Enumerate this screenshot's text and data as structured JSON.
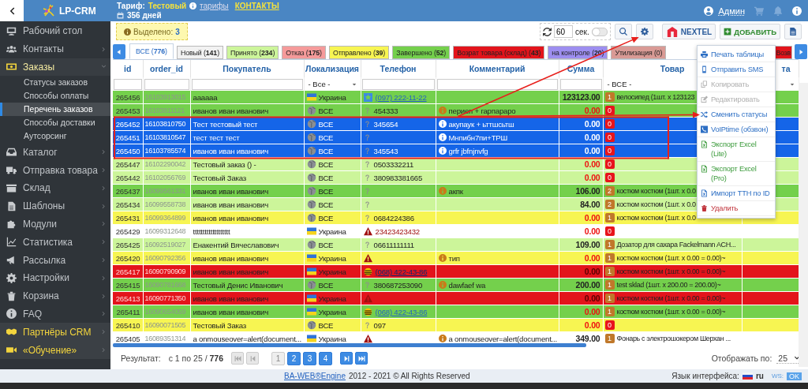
{
  "header": {
    "logo": "LP-CRM",
    "tariff_label": "Тариф:",
    "tariff": "Тестовый",
    "tariffs_link": "тарифы",
    "contacts_link": "КОНТАКТЫ",
    "days": "356 дней",
    "user": "Админ"
  },
  "sidebar": {
    "items": [
      {
        "label": "Рабочий стол",
        "has_arrow": false,
        "expanded": false,
        "highlight": false
      },
      {
        "label": "Контакты",
        "has_arrow": true,
        "expanded": false,
        "highlight": false
      },
      {
        "label": "Заказы",
        "has_arrow": true,
        "expanded": true,
        "highlight": false,
        "children": [
          {
            "label": "Статусы заказов",
            "selected": false
          },
          {
            "label": "Способы оплаты",
            "selected": false
          },
          {
            "label": "Перечень заказов",
            "selected": true
          },
          {
            "label": "Способы доставки",
            "selected": false
          },
          {
            "label": "Аутсорсинг",
            "selected": false
          }
        ]
      },
      {
        "label": "Каталог",
        "has_arrow": true,
        "expanded": false,
        "highlight": false
      },
      {
        "label": "Отправка товара",
        "has_arrow": true,
        "expanded": false,
        "highlight": false
      },
      {
        "label": "Склад",
        "has_arrow": true,
        "expanded": false,
        "highlight": false
      },
      {
        "label": "Шаблоны",
        "has_arrow": true,
        "expanded": false,
        "highlight": false
      },
      {
        "label": "Модули",
        "has_arrow": true,
        "expanded": false,
        "highlight": false
      },
      {
        "label": "Статистика",
        "has_arrow": true,
        "expanded": false,
        "highlight": false
      },
      {
        "label": "Рассылка",
        "has_arrow": true,
        "expanded": false,
        "highlight": false
      },
      {
        "label": "Настройки",
        "has_arrow": true,
        "expanded": false,
        "highlight": false
      },
      {
        "label": "Корзина",
        "has_arrow": true,
        "expanded": false,
        "highlight": false
      },
      {
        "label": "FAQ",
        "has_arrow": true,
        "expanded": false,
        "highlight": false
      },
      {
        "label": "Партнёры CRM",
        "has_arrow": true,
        "expanded": false,
        "highlight": true
      },
      {
        "label": "«Обучение»",
        "has_arrow": true,
        "expanded": false,
        "highlight": true
      }
    ]
  },
  "toolbar": {
    "selected_label": "Выделено:",
    "selected_count": "3",
    "refresh_value": "60",
    "refresh_unit": "сек.",
    "auto_refresh": false,
    "nextel": "NEXTEL",
    "add": "ДОБАВИТЬ"
  },
  "tabs": [
    {
      "label": "ВСЕ (**776**)",
      "selected": true,
      "color": "#ffffff"
    },
    {
      "label": "Новый (**141**)",
      "selected": false,
      "color": "#f2f2f2"
    },
    {
      "label": "Принято (**234**)",
      "selected": false,
      "color": "#ccf59a"
    },
    {
      "label": "Отказ (**175**)",
      "selected": false,
      "color": "#f59a9a"
    },
    {
      "label": "Отправлено (**39**)",
      "selected": false,
      "color": "#f7f552"
    },
    {
      "label": "Завершено (**52**)",
      "selected": false,
      "color": "#74d04c"
    },
    {
      "label": "Возрат товара (склад) (**43**)",
      "selected": false,
      "color": "#e3141b"
    },
    {
      "label": "на контроле (**20**)",
      "selected": false,
      "color": "#9d8ef0"
    },
    {
      "label": "Утилизация (0)",
      "selected": false,
      "color": "#d99a95"
    },
    {
      "label": "Возв",
      "selected": false,
      "color": "#e3141b"
    }
  ],
  "table": {
    "columns": [
      "id",
      "order_id",
      "Покупатель",
      "Локализация",
      "Телефон",
      "Комментарий",
      "Сумма",
      "Товар",
      "та"
    ],
    "filters": [
      {
        "kind": "text"
      },
      {
        "kind": "text"
      },
      {
        "kind": "text"
      },
      {
        "kind": "select",
        "value": "- Все -"
      },
      {
        "kind": "text"
      },
      {
        "kind": "text"
      },
      {
        "kind": "text"
      },
      {
        "kind": "select",
        "value": "- ВСЕ -"
      }
    ],
    "rows": [
      {
        "id": "265456",
        "order_id": "16103913015",
        "buyer": "аааааа",
        "location": {
          "kind": "flag",
          "label": "Украина"
        },
        "phone": {
          "kind": "star",
          "number": "(097) 222-11-22",
          "link": true
        },
        "comment": "",
        "sum": "123123.00",
        "sum_alert": false,
        "badge": {
          "count": "1",
          "color": "#c0782a"
        },
        "product": "велосипед (1шт. x 123123",
        "color": "#74d04c",
        "selected": false
      },
      {
        "id": "265453",
        "order_id": "16103811121",
        "buyer": "иванов иван иванович",
        "location": {
          "kind": "globe",
          "label": "ВСЕ"
        },
        "phone": {
          "kind": "unknown",
          "number": "454333",
          "link": false
        },
        "comment": "периеп + гарпараро",
        "sum": "0.00",
        "sum_alert": true,
        "badge": {
          "count": "0",
          "color": "#e8141c"
        },
        "product": "",
        "color": "#74d04c",
        "selected": false
      },
      {
        "id": "265452",
        "order_id": "16103810750",
        "buyer": "Тест тестовый тест",
        "location": {
          "kind": "globe",
          "label": "ВСЕ"
        },
        "phone": {
          "kind": "unknown",
          "number": "345654",
          "link": false
        },
        "comment": "акупаук + ьттшсьтш",
        "sum": "0.00",
        "sum_alert": true,
        "badge": {
          "count": "0",
          "color": "#e8141c"
        },
        "product": "",
        "selected": true
      },
      {
        "id": "265451",
        "order_id": "16103810547",
        "buyer": "тест тест тест",
        "location": {
          "kind": "globe",
          "label": "ВСЕ"
        },
        "phone": {
          "kind": "unknown"
        },
        "comment": "Мнпибн7пи+ТРШ",
        "sum": "0.00",
        "sum_alert": true,
        "badge": {
          "count": "0",
          "color": "#e8141c"
        },
        "product": "",
        "selected": true
      },
      {
        "id": "265450",
        "order_id": "16103785574",
        "buyer": "иванов иван иванович",
        "location": {
          "kind": "globe",
          "label": "ВСЕ"
        },
        "phone": {
          "kind": "unknown",
          "number": "345543",
          "link": false
        },
        "comment": "grfr jbfnjnvfg",
        "sum": "0.00",
        "sum_alert": true,
        "badge": {
          "count": "0",
          "color": "#e8141c"
        },
        "product": "",
        "selected": true
      },
      {
        "id": "265447",
        "order_id": "16102290042",
        "buyer": "Тестовый заказ () -",
        "location": {
          "kind": "globe",
          "label": "ВСЕ"
        },
        "phone": {
          "kind": "unknown",
          "number": "0503332211",
          "link": false
        },
        "comment": "",
        "sum": "0.00",
        "sum_alert": true,
        "badge": {
          "count": "0",
          "color": "#e8141c"
        },
        "product": "",
        "color": "#ccf59a",
        "selected": false
      },
      {
        "id": "265442",
        "order_id": "16102056769",
        "buyer": "Тестовый Заказ",
        "location": {
          "kind": "globe",
          "label": "ВСЕ"
        },
        "phone": {
          "kind": "unknown",
          "number": "380983381665",
          "link": false
        },
        "comment": "",
        "sum": "0.00",
        "sum_alert": true,
        "badge": {
          "count": "0",
          "color": "#e8141c"
        },
        "product": "",
        "color": "#ccf59a",
        "selected": false
      },
      {
        "id": "265437",
        "order_id": "16099561331",
        "buyer": "иванов иван иванович",
        "location": {
          "kind": "globe",
          "label": "ВСЕ"
        },
        "phone": {
          "kind": "unknown"
        },
        "comment": "акпк",
        "sum": "106.00",
        "sum_alert": false,
        "badge": {
          "count": "2",
          "color": "#c0782a"
        },
        "product": "костюм костюм (1шт. x 0.0",
        "color": "#74d04c",
        "selected": false
      },
      {
        "id": "265434",
        "order_id": "16099558738",
        "buyer": "иванов иван иванович",
        "location": {
          "kind": "globe",
          "label": "ВСЕ"
        },
        "phone": {
          "kind": "unknown"
        },
        "comment": "",
        "sum": "84.00",
        "sum_alert": false,
        "badge": {
          "count": "2",
          "color": "#c0782a"
        },
        "product": "костюм костюм (1шт. x 0.0",
        "color": "#ccf59a",
        "selected": false
      },
      {
        "id": "265431",
        "order_id": "16099364899",
        "buyer": "иванов иван иванович",
        "location": {
          "kind": "globe",
          "label": "ВСЕ"
        },
        "phone": {
          "kind": "unknown",
          "number": "0684224386",
          "link": false
        },
        "comment": "",
        "sum": "0.00",
        "sum_alert": true,
        "badge": {
          "count": "1",
          "color": "#c0782a"
        },
        "product": "костюм костюм (1шт. x 0.0",
        "color": "#f7f552",
        "selected": false
      },
      {
        "id": "265429",
        "order_id": "16099312648",
        "buyer": "ttttttttttttttttttt",
        "location": {
          "kind": "flag",
          "label": "Украина"
        },
        "phone": {
          "kind": "warning",
          "number": "23423423432",
          "link": false
        },
        "comment": "",
        "sum": "0.00",
        "sum_alert": true,
        "badge": {
          "count": "0",
          "color": "#e8141c"
        },
        "product": "",
        "color": "#ffffff",
        "selected": false
      },
      {
        "id": "265425",
        "order_id": "16092519027",
        "buyer": "Енакентий Вячеславович",
        "location": {
          "kind": "globe",
          "label": "ВСЕ"
        },
        "phone": {
          "kind": "unknown",
          "number": "06611111111",
          "link": false
        },
        "comment": "",
        "sum": "109.00",
        "sum_alert": false,
        "badge": {
          "count": "1",
          "color": "#c0782a"
        },
        "product": "Дозатор для сахара Fackelmann ACH...",
        "color": "#ccf59a",
        "selected": false
      },
      {
        "id": "265420",
        "order_id": "16090792356",
        "buyer": "иванов иван иванович",
        "location": {
          "kind": "flag",
          "label": "Украина"
        },
        "phone": {
          "kind": "warning"
        },
        "comment": "тип",
        "sum": "0.00",
        "sum_alert": true,
        "badge": {
          "count": "1",
          "color": "#c0782a"
        },
        "product": "костюм костюм (1шт. x 0.00 = 0.00)~",
        "color": "#f7f552",
        "selected": false
      },
      {
        "id": "265417",
        "order_id": "16090790909",
        "buyer": "иванов иван иванович",
        "location": {
          "kind": "flag",
          "label": "Украина"
        },
        "phone": {
          "kind": "operator",
          "number": "(068) 422-43-86",
          "link": true
        },
        "comment": "",
        "sum": "0.00",
        "sum_alert": true,
        "badge": {
          "count": "1",
          "color": "#c0782a"
        },
        "product": "костюм костюм (1шт. x 0.00 = 0.00)~",
        "color": "#e3141b",
        "selected": false
      },
      {
        "id": "265415",
        "order_id": "16090781668",
        "buyer": "Тестовый Денис Иванович",
        "location": {
          "kind": "globe",
          "label": "ВСЕ"
        },
        "phone": {
          "kind": "unknown",
          "number": "380687253090",
          "link": false
        },
        "comment": "dawfaef wa",
        "sum": "200.00",
        "sum_alert": false,
        "badge": {
          "count": "1",
          "color": "#c0782a"
        },
        "product": "test sklad (1шт. x 200.00 = 200.00)~",
        "color": "#74d04c",
        "selected": false
      },
      {
        "id": "265413",
        "order_id": "16090771350",
        "buyer": "иванов иван иванович",
        "location": {
          "kind": "flag",
          "label": "Украина"
        },
        "phone": {
          "kind": "warning"
        },
        "comment": "",
        "sum": "0.00",
        "sum_alert": true,
        "badge": {
          "count": "1",
          "color": "#c0782a"
        },
        "product": "костюм костюм (1шт. x 0.00 = 0.00)~",
        "color": "#e3141b",
        "selected": false
      },
      {
        "id": "265411",
        "order_id": "16090654059",
        "buyer": "иванов иван иванович",
        "location": {
          "kind": "flag",
          "label": "Украина"
        },
        "phone": {
          "kind": "operator",
          "number": "(068) 422-43-86",
          "link": true
        },
        "comment": "",
        "sum": "0.00",
        "sum_alert": true,
        "badge": {
          "count": "1",
          "color": "#c0782a"
        },
        "product": "костюм костюм (1шт. x 0.00 = 0.00)~",
        "color": "#74d04c",
        "selected": false
      },
      {
        "id": "265410",
        "order_id": "16090071505",
        "buyer": "Тестовый Заказ",
        "location": {
          "kind": "globe",
          "label": "ВСЕ"
        },
        "phone": {
          "kind": "unknown",
          "number": "097",
          "link": false
        },
        "comment": "",
        "sum": "0.00",
        "sum_alert": true,
        "badge": {
          "count": "0",
          "color": "#e8141c"
        },
        "product": "",
        "color": "#f7f552",
        "selected": false
      },
      {
        "id": "265405",
        "order_id": "16089351314",
        "buyer": "a onmouseover=alert(document...",
        "location": {
          "kind": "flag",
          "label": "Украина"
        },
        "phone": {
          "kind": "warning"
        },
        "comment": "a onmouseover=alert(document...",
        "sum": "349.00",
        "sum_alert": false,
        "badge": {
          "count": "1",
          "color": "#c0782a"
        },
        "product": "Фонарь с электрошокером Шерхан ...",
        "color": "#ffffff",
        "selected": false
      }
    ]
  },
  "context_menu": {
    "items": [
      {
        "label": "Печать таблицы",
        "kind": "normal"
      },
      {
        "label": "Отправить SMS",
        "kind": "normal"
      },
      {
        "label": "Копировать",
        "kind": "disabled"
      },
      {
        "label": "Редактировать",
        "kind": "disabled"
      },
      {
        "label": "Сменить статусы",
        "kind": "normal"
      },
      {
        "label": "VoIPtime (обзвон)",
        "kind": "normal"
      },
      {
        "label": "Экспорт Excel (Lite)",
        "kind": "excel"
      },
      {
        "label": "Экспорт Excel (Pro)",
        "kind": "excel"
      },
      {
        "label": "Импорт ТТН по ID",
        "kind": "normal"
      },
      {
        "label": "Удалить",
        "kind": "danger"
      }
    ]
  },
  "pagination": {
    "result_label": "Результат:",
    "range": "с 1 по 25 / **776**",
    "nav_before": [
      {
        "kind": "first",
        "disabled": true
      },
      {
        "kind": "prev",
        "disabled": true
      }
    ],
    "pages": [
      {
        "label": "1",
        "selected": true
      },
      {
        "label": "2",
        "selected": false
      },
      {
        "label": "3",
        "selected": false
      },
      {
        "label": "4",
        "selected": false
      }
    ],
    "nav_after": [
      {
        "kind": "next",
        "disabled": false
      },
      {
        "kind": "last",
        "disabled": false
      }
    ],
    "per_page_label": "Отображать по:",
    "per_page": "25"
  },
  "footer": {
    "engine_link": "BA-WEB®Engine",
    "copyright": "2012 - 2021 © All Rights Reserved",
    "language_label": "Язык интерфейса:",
    "language": "ru",
    "ws_label": "WS:",
    "ws_status": "OK"
  }
}
